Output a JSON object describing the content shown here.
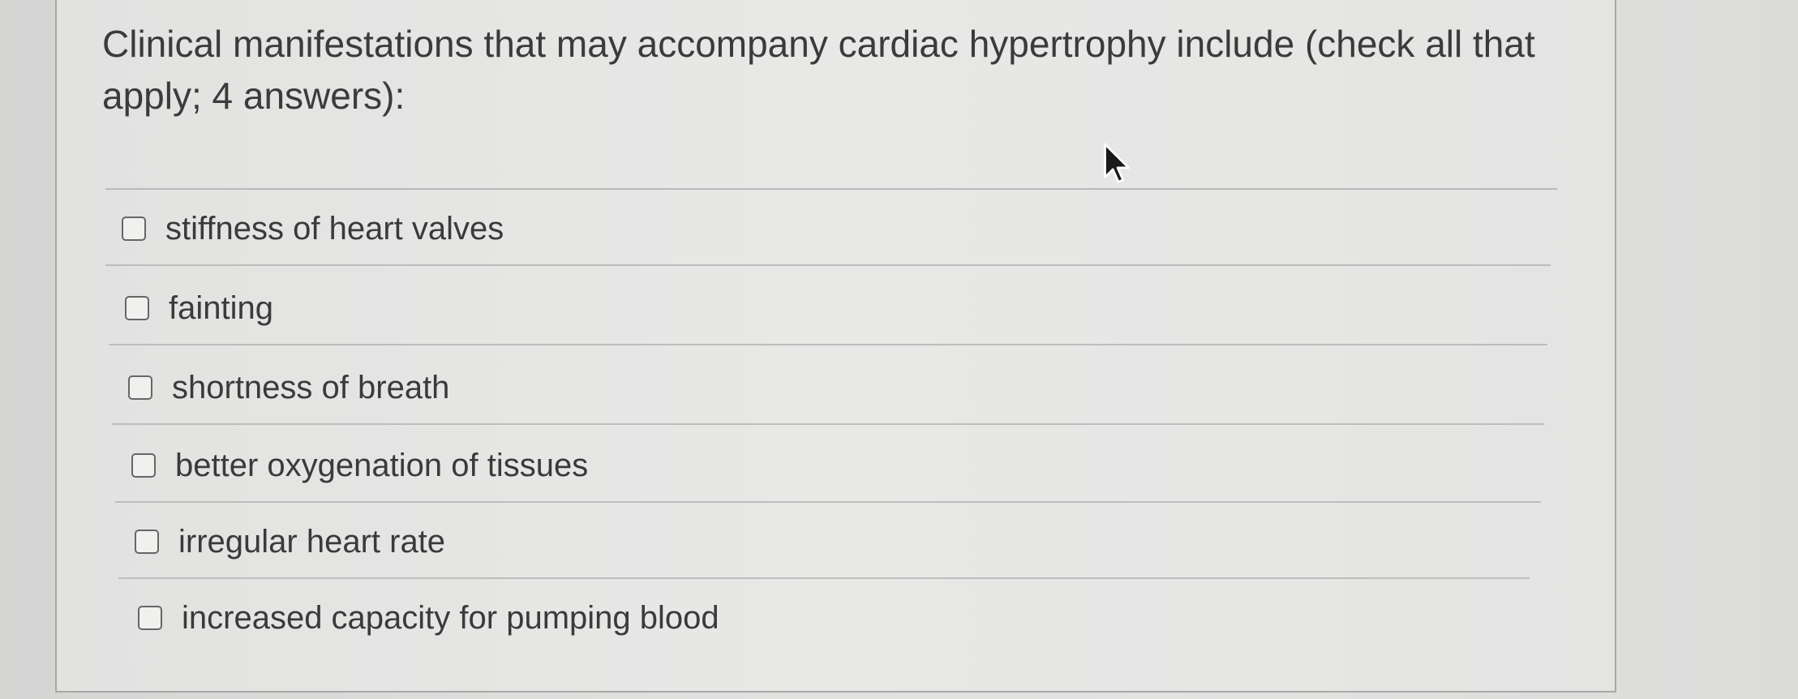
{
  "question": {
    "prompt": "Clinical manifestations that may accompany cardiac hypertrophy include (check all that apply; 4 answers):"
  },
  "options": [
    {
      "label": "stiffness of heart valves",
      "checked": false
    },
    {
      "label": "fainting",
      "checked": false
    },
    {
      "label": "shortness of breath",
      "checked": false
    },
    {
      "label": "better oxygenation of tissues",
      "checked": false
    },
    {
      "label": "irregular heart rate",
      "checked": false
    },
    {
      "label": "increased capacity for pumping blood",
      "checked": false
    }
  ],
  "icons": {
    "pointer": "mouse-pointer-icon",
    "checkbox": "checkbox-unchecked-icon"
  },
  "colors": {
    "text": "#3a3a3a",
    "divider": "#bdbdbd",
    "checkbox_border": "#666666",
    "background": "#e5e5e4"
  }
}
